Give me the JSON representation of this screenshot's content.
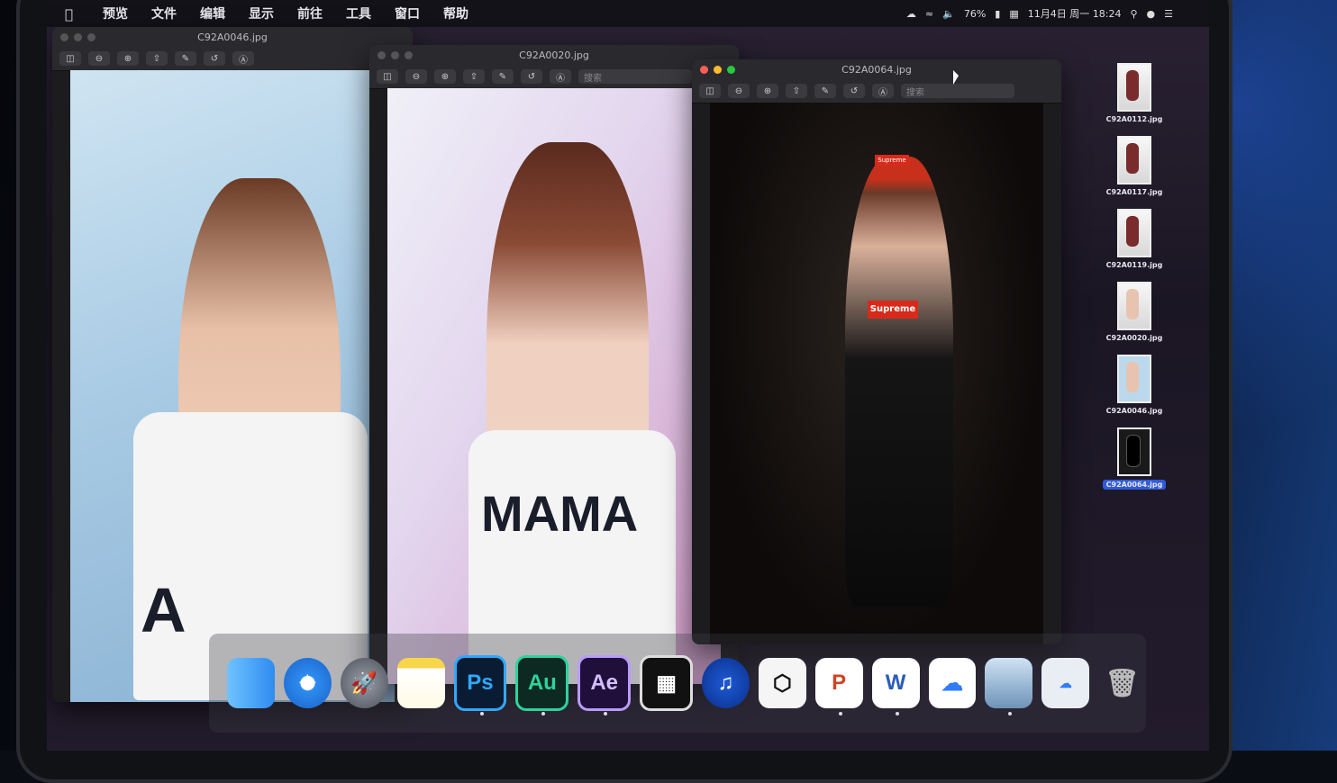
{
  "menubar": {
    "app_name": "预览",
    "items": [
      "文件",
      "编辑",
      "显示",
      "前往",
      "工具",
      "窗口",
      "帮助"
    ],
    "status": {
      "battery": "76%",
      "datetime": "11月4日 周一 18:24"
    }
  },
  "windows": [
    {
      "title": "C92A0046.jpg",
      "active": false,
      "shirt_text": "A"
    },
    {
      "title": "C92A0020.jpg",
      "active": false,
      "shirt_text": "MAMA",
      "search_placeholder": "搜索"
    },
    {
      "title": "C92A0064.jpg",
      "active": true,
      "search_placeholder": "搜索",
      "cap_text": "Supreme",
      "shirt_text": "Supreme"
    }
  ],
  "toolbar_icons": [
    "sidebar-icon",
    "zoom-out-icon",
    "zoom-in-icon",
    "share-icon",
    "markup-pen-icon",
    "rotate-icon",
    "annotate-icon"
  ],
  "desktop_files": [
    {
      "name": "C92A0112.jpg",
      "selected": false
    },
    {
      "name": "C92A0117.jpg",
      "selected": false
    },
    {
      "name": "C92A0119.jpg",
      "selected": false
    },
    {
      "name": "C92A0020.jpg",
      "selected": false
    },
    {
      "name": "C92A0046.jpg",
      "selected": false
    },
    {
      "name": "C92A0064.jpg",
      "selected": true
    }
  ],
  "dock": {
    "ps": "Ps",
    "au": "Au",
    "ae": "Ae",
    "ppt": "P",
    "word": "W"
  }
}
